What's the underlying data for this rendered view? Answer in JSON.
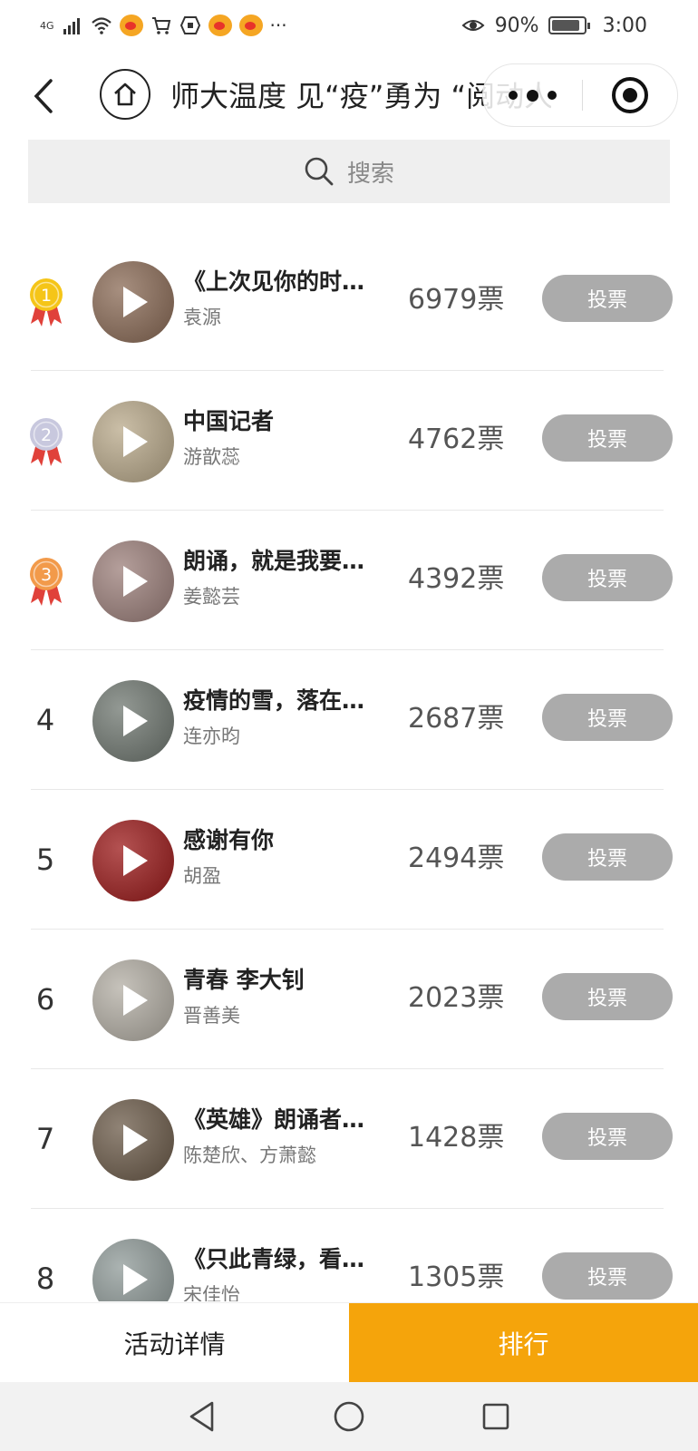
{
  "status_bar": {
    "network": "4G",
    "notification_icons": [
      "signal-icon",
      "wifi-icon",
      "weibo-icon",
      "cart-icon",
      "shield-icon",
      "weibo-icon",
      "weibo-icon"
    ],
    "more": "···",
    "battery_percent": "90%",
    "time": "3:00"
  },
  "nav": {
    "title": "师大温度 见“疫”勇为 “阅动人生”"
  },
  "search": {
    "placeholder": "搜索"
  },
  "ranking": [
    {
      "rank": "1",
      "title": "《上次见你的时候…",
      "author": "袁源",
      "votes": "6979票",
      "button": "投票",
      "thumb_color": "#8a6a55"
    },
    {
      "rank": "2",
      "title": "中国记者",
      "author": "游歆蕊",
      "votes": "4762票",
      "button": "投票",
      "thumb_color": "#b9a98a"
    },
    {
      "rank": "3",
      "title": "朗诵，就是我要…",
      "author": "姜懿芸",
      "votes": "4392票",
      "button": "投票",
      "thumb_color": "#9c7f7a"
    },
    {
      "rank": "4",
      "title": "疫情的雪，落在…",
      "author": "连亦昀",
      "votes": "2687票",
      "button": "投票",
      "thumb_color": "#6f7770"
    },
    {
      "rank": "5",
      "title": "感谢有你",
      "author": "胡盈",
      "votes": "2494票",
      "button": "投票",
      "thumb_color": "#9b1818"
    },
    {
      "rank": "6",
      "title": "青春 李大钊",
      "author": "晋善美",
      "votes": "2023票",
      "button": "投票",
      "thumb_color": "#b3aea4"
    },
    {
      "rank": "7",
      "title": "《英雄》朗诵者…",
      "author": "陈楚欣、方萧懿",
      "votes": "1428票",
      "button": "投票",
      "thumb_color": "#6b5a48"
    },
    {
      "rank": "8",
      "title": "《只此青绿，看…",
      "author": "宋佳怡",
      "votes": "1305票",
      "button": "投票",
      "thumb_color": "#8f9a98"
    }
  ],
  "bottom_tabs": {
    "detail": "活动详情",
    "rank": "排行"
  },
  "colors": {
    "accent": "#f5a40b",
    "vote_button": "#ababab",
    "gold": "#f5c518",
    "silver": "#c8c8de",
    "bronze": "#f29a4a",
    "ribbon": "#e0413a"
  }
}
